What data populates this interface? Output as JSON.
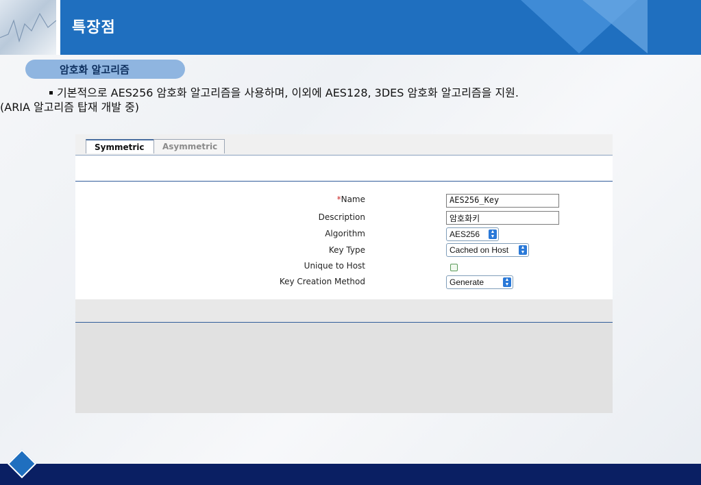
{
  "slide": {
    "title": "특장점",
    "section_pill": "암호화 알고리즘",
    "bullet_line1": "기본적으로 AES256 암호화 알고리즘을 사용하며, 이외에 AES128, 3DES 암호화 알고리즘을 지원.",
    "bullet_line2": "(ARIA 알고리즘 탑재 개발 중)"
  },
  "tabs": [
    {
      "label": "Symmetric",
      "active": true
    },
    {
      "label": "Asymmetric",
      "active": false
    }
  ],
  "form": {
    "name_required_mark": "*",
    "name_label": "Name",
    "name_value": "AES256_Key",
    "description_label": "Description",
    "description_value": "암호화키",
    "algorithm_label": "Algorithm",
    "algorithm_value": "AES256",
    "key_type_label": "Key Type",
    "key_type_value": "Cached on Host",
    "unique_label": "Unique to Host",
    "unique_checked": false,
    "creation_label": "Key Creation Method",
    "creation_value": "Generate",
    "select_arrow_icon": "updown-arrows-icon"
  },
  "colors": {
    "header_blue": "#1f6fbf",
    "bottom_bar": "#0a1f63",
    "pill": "#8fb5e0",
    "required": "#cc2b2b"
  }
}
